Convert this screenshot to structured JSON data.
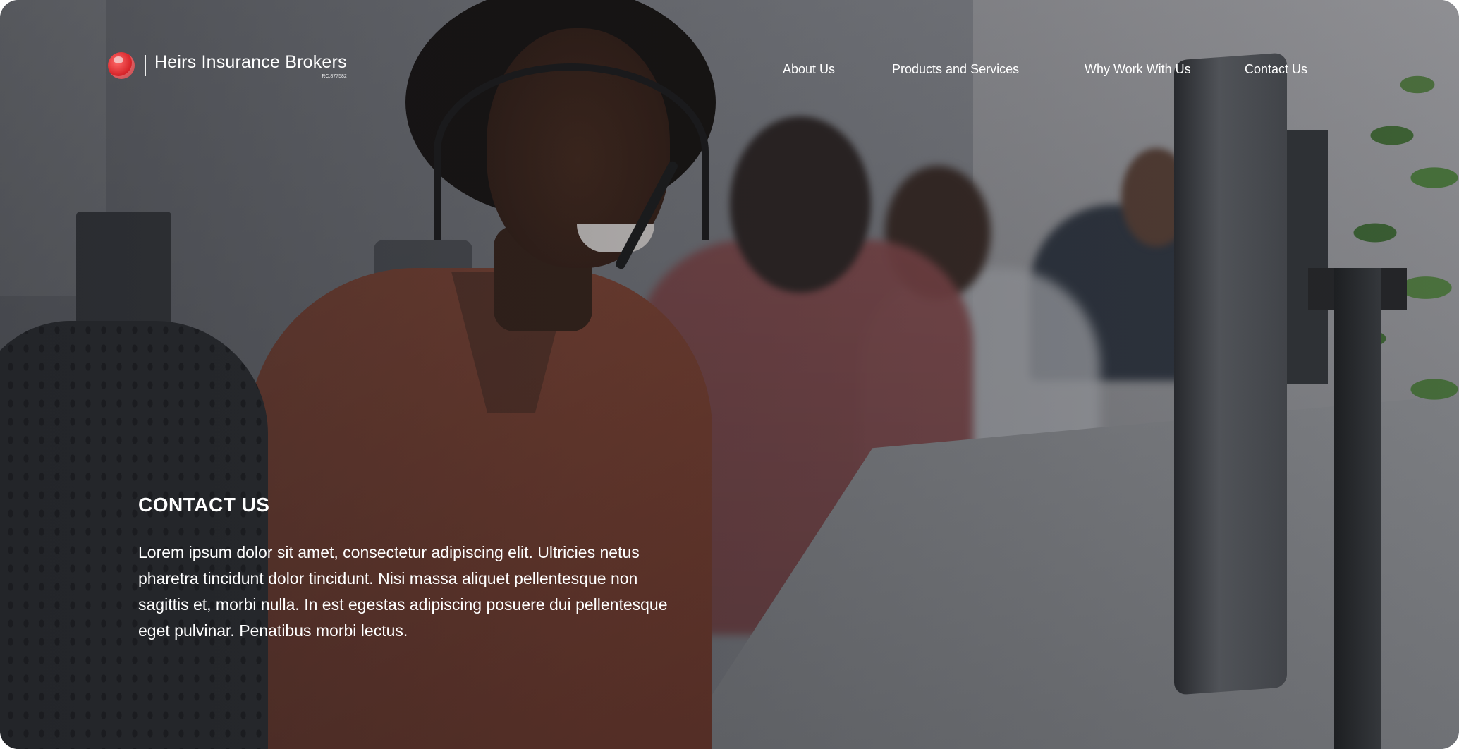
{
  "brand": {
    "name": "Heirs Insurance Brokers",
    "registration": "RC:877582",
    "logo_icon": "globe-icon",
    "accent_color": "#d8262b"
  },
  "nav": {
    "items": [
      {
        "label": "About Us"
      },
      {
        "label": "Products and Services"
      },
      {
        "label": "Why Work With Us"
      },
      {
        "label": "Contact Us"
      }
    ]
  },
  "hero": {
    "title": "CONTACT US",
    "body": "Lorem ipsum dolor sit amet, consectetur adipiscing elit. Ultricies netus pharetra tincidunt dolor tincidunt. Nisi massa aliquet pellentesque non sagittis et, morbi nulla. In est egestas adipiscing posuere dui pellentesque eget pulvinar. Penatibus morbi lectus."
  }
}
